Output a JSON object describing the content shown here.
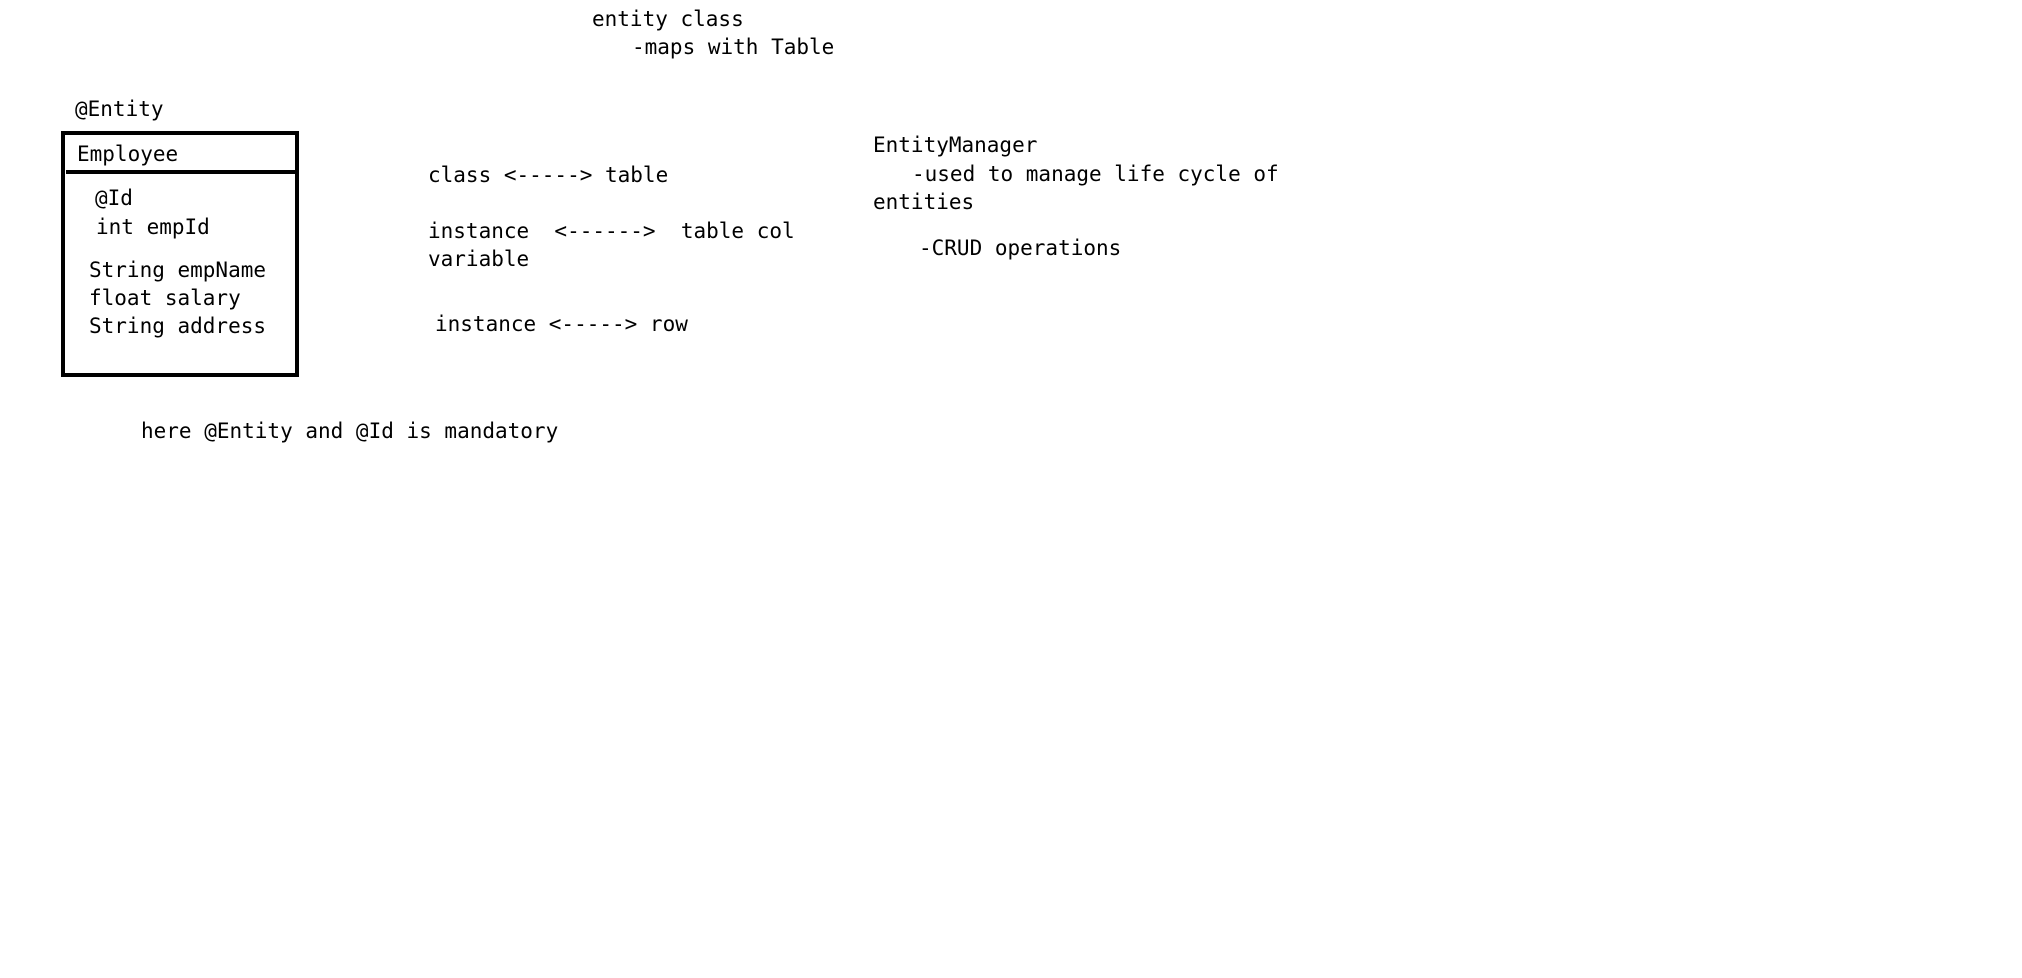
{
  "notes": {
    "entity_class_title": "entity class",
    "entity_class_desc": "-maps with Table",
    "entity_annotation": "@Entity",
    "class_table": "class <-----> table",
    "instance_variable_line1": "instance  <------>  table col",
    "instance_variable_line2": "variable",
    "instance_row": "instance <-----> row",
    "entity_manager_title": "EntityManager",
    "entity_manager_desc_line1": "-used to manage life cycle of",
    "entity_manager_desc_line2": "entities",
    "entity_manager_crud": "-CRUD operations",
    "footer_note": "here @Entity and @Id is mandatory"
  },
  "employee_box": {
    "title": "Employee",
    "id_annotation": "@Id",
    "fields": [
      "int empId",
      "String empName",
      "float salary",
      "String address"
    ]
  }
}
